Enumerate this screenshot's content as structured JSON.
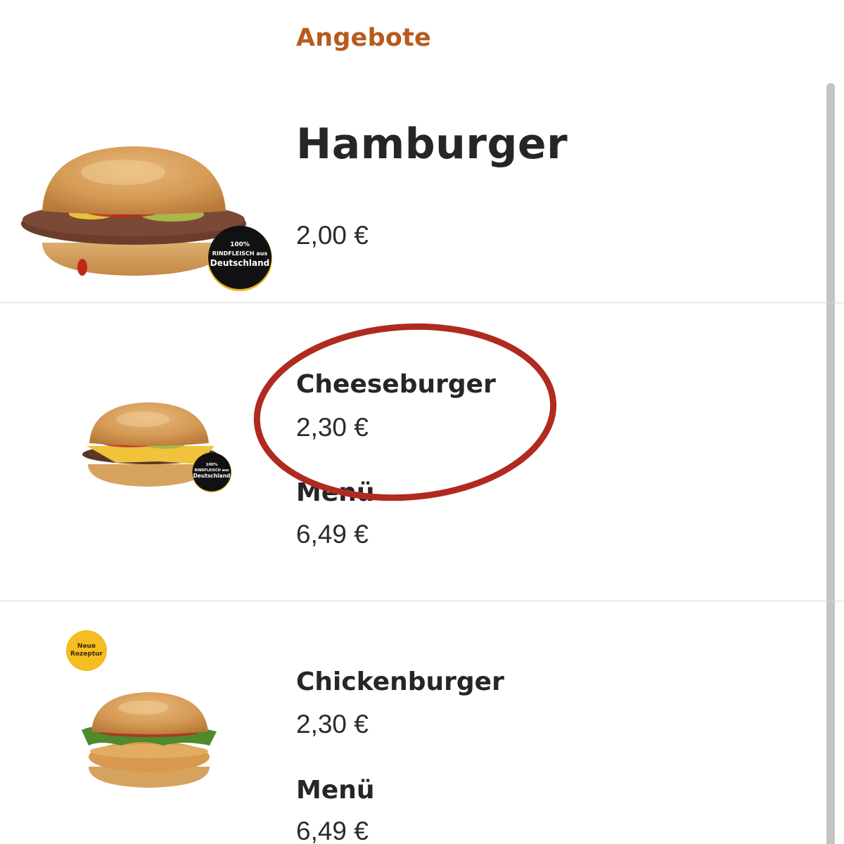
{
  "category": {
    "title": "Angebote"
  },
  "products": [
    {
      "name": "Hamburger",
      "price": "2,00 €",
      "badge": {
        "lines": [
          "100%",
          "RINDFLEISCH aus",
          "Deutschland"
        ]
      }
    },
    {
      "name": "Cheeseburger",
      "price": "2,30 €",
      "menu_label": "Menü",
      "menu_price": "6,49 €",
      "badge": {
        "lines": [
          "100%",
          "RINDFLEISCH aus",
          "Deutschland"
        ]
      },
      "highlight_color": "#b02a1f"
    },
    {
      "name": "Chickenburger",
      "price": "2,30 €",
      "menu_label": "Menü",
      "menu_price": "6,49 €",
      "badge": {
        "lines": [
          "Neue",
          "Rezeptur"
        ],
        "color": "#f5bd1f"
      }
    }
  ],
  "colors": {
    "accent": "#b85a1e",
    "text": "#262626",
    "divider": "#d9d9d9",
    "scrollbar": "#c4c4c4"
  }
}
